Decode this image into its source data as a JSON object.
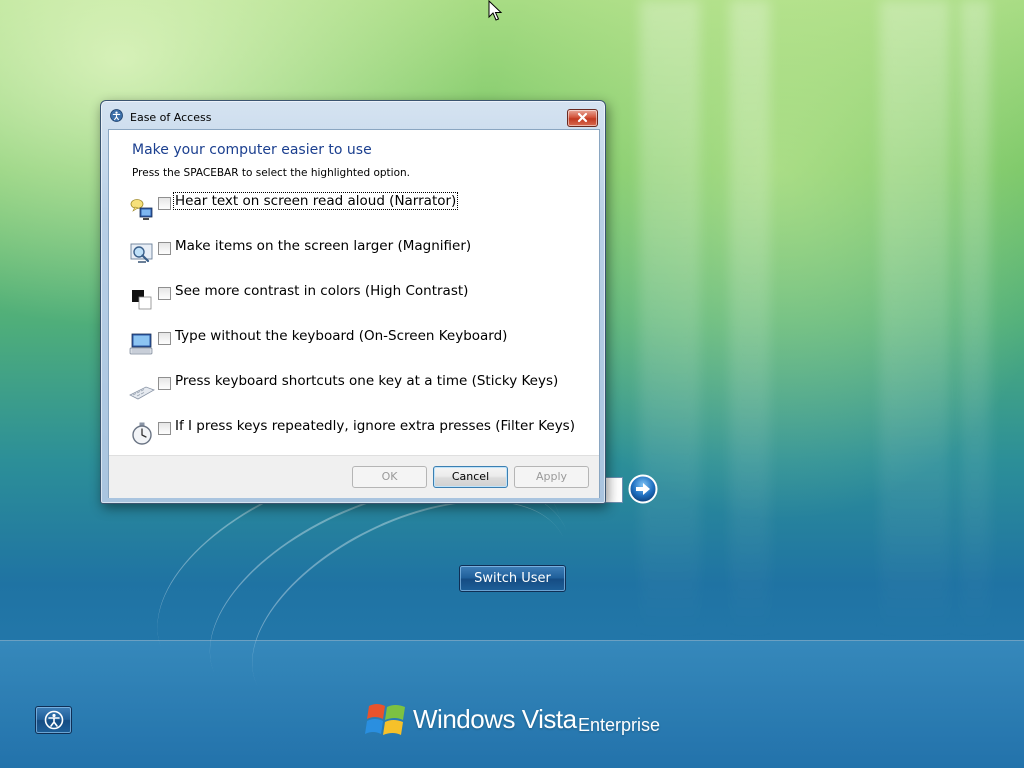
{
  "window": {
    "title": "Ease of Access",
    "close_icon": "close-icon",
    "title_icon": "ease-of-access-icon"
  },
  "dialog": {
    "heading": "Make your computer easier to use",
    "instruction": "Press the SPACEBAR to select the highlighted option.",
    "options": [
      {
        "label": "Hear text on screen read aloud (Narrator)",
        "icon": "narrator-icon",
        "checked": false,
        "focused": true
      },
      {
        "label": "Make items on the screen larger (Magnifier)",
        "icon": "magnifier-icon",
        "checked": false,
        "focused": false
      },
      {
        "label": "See more contrast in colors (High Contrast)",
        "icon": "high-contrast-icon",
        "checked": false,
        "focused": false
      },
      {
        "label": "Type without the keyboard (On-Screen Keyboard)",
        "icon": "on-screen-keyboard-icon",
        "checked": false,
        "focused": false
      },
      {
        "label": "Press keyboard shortcuts one key at a time (Sticky Keys)",
        "icon": "sticky-keys-icon",
        "checked": false,
        "focused": false
      },
      {
        "label": "If I press keys repeatedly, ignore extra presses (Filter Keys)",
        "icon": "filter-keys-icon",
        "checked": false,
        "focused": false
      }
    ],
    "buttons": {
      "ok": "OK",
      "cancel": "Cancel",
      "apply": "Apply"
    }
  },
  "login": {
    "switch_user": "Switch User",
    "go_icon": "arrow-right-icon",
    "ease_icon": "ease-of-access-icon"
  },
  "branding": {
    "product": "Windows Vista",
    "edition": "Enterprise",
    "logo_icon": "windows-flag-icon"
  },
  "colors": {
    "heading_blue": "#1b3f8f",
    "close_red": "#c13a22",
    "button_blue": "#1f5f9a"
  }
}
